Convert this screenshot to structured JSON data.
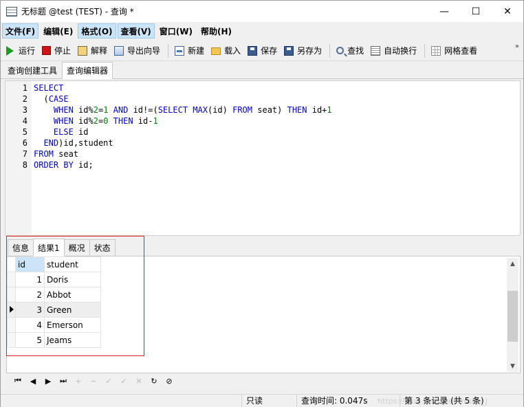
{
  "window": {
    "title": "无标题 @test (TEST) - 查询 *",
    "minimize_glyph": "—",
    "maximize_glyph": "☐",
    "close_glyph": "✕"
  },
  "menu": {
    "items": [
      "文件(F)",
      "编辑(E)",
      "格式(O)",
      "查看(V)",
      "窗口(W)",
      "帮助(H)"
    ]
  },
  "toolbar": {
    "run": "运行",
    "stop": "停止",
    "explain": "解释",
    "export_wizard": "导出向导",
    "new": "新建",
    "load": "载入",
    "save": "保存",
    "save_as": "另存为",
    "find": "查找",
    "word_wrap": "自动换行",
    "grid_view": "网格查看",
    "more_glyph": "»"
  },
  "editor_tabs": [
    "查询创建工具",
    "查询编辑器"
  ],
  "editor": {
    "line_numbers": [
      "1",
      "2",
      "3",
      "4",
      "5",
      "6",
      "7",
      "8"
    ]
  },
  "result_tabs": [
    "信息",
    "结果1",
    "概况",
    "状态"
  ],
  "results": {
    "columns": [
      "id",
      "student"
    ],
    "rows": [
      {
        "id": "1",
        "student": "Doris"
      },
      {
        "id": "2",
        "student": "Abbot"
      },
      {
        "id": "3",
        "student": "Green"
      },
      {
        "id": "4",
        "student": "Emerson"
      },
      {
        "id": "5",
        "student": "Jeams"
      }
    ]
  },
  "navigator": {
    "first": "⏮",
    "prev": "◀",
    "next": "▶",
    "last": "⏭",
    "add": "+",
    "delete": "−",
    "edit": "✓",
    "apply": "✓",
    "discard": "✕",
    "refresh": "↻",
    "stop": "⊘"
  },
  "status": {
    "readonly": "只读",
    "query_time": "查询时间: 0.047s",
    "record": "第 3 条记录 (共 5 条)",
    "watermark": "https://blog.csdn.net/misite_J"
  },
  "colors": {
    "keyword": "#0000cc",
    "number": "#008000",
    "highlight_box": "#e02020",
    "menu_active": "#cce4f7"
  }
}
